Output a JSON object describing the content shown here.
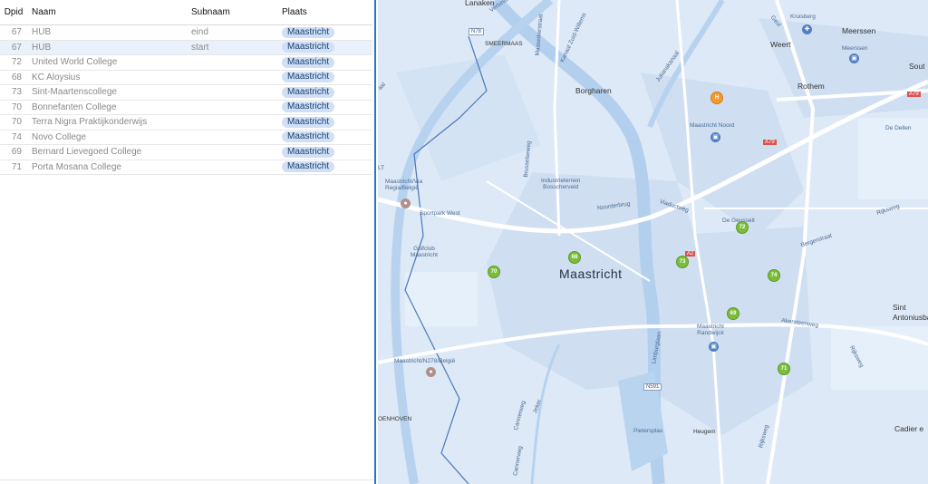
{
  "table": {
    "headers": {
      "dpid": "Dpid",
      "naam": "Naam",
      "subnaam": "Subnaam",
      "plaats": "Plaats"
    },
    "rows": [
      {
        "dpid": "67",
        "naam": "HUB",
        "subnaam": "eind",
        "plaats": "Maastricht"
      },
      {
        "dpid": "67",
        "naam": "HUB",
        "subnaam": "start",
        "plaats": "Maastricht"
      },
      {
        "dpid": "72",
        "naam": "United World College",
        "subnaam": "",
        "plaats": "Maastricht"
      },
      {
        "dpid": "68",
        "naam": "KC Aloysius",
        "subnaam": "",
        "plaats": "Maastricht"
      },
      {
        "dpid": "73",
        "naam": "Sint-Maartenscollege",
        "subnaam": "",
        "plaats": "Maastricht"
      },
      {
        "dpid": "70",
        "naam": "Bonnefanten College",
        "subnaam": "",
        "plaats": "Maastricht"
      },
      {
        "dpid": "70",
        "naam": "Terra Nigra Praktijkonderwijs",
        "subnaam": "",
        "plaats": "Maastricht"
      },
      {
        "dpid": "74",
        "naam": "Novo College",
        "subnaam": "",
        "plaats": "Maastricht"
      },
      {
        "dpid": "69",
        "naam": "Bernard Lievegoed College",
        "subnaam": "",
        "plaats": "Maastricht"
      },
      {
        "dpid": "71",
        "naam": "Porta Mosana College",
        "subnaam": "",
        "plaats": "Maastricht"
      }
    ]
  },
  "map": {
    "city": "Maastricht",
    "towns": {
      "lanaken": "Lanaken",
      "smeermaas": "SMEERMAAS",
      "borgharen": "Borgharen",
      "weert": "Weert",
      "meerssen": "Meerssen",
      "meerssen_station": "Meerssen",
      "rothem": "Rothem",
      "kruisberg": "Kruisberg",
      "de_dellen": "De Dellen",
      "sint_antoniusbank": "Sint\nAntoniusban",
      "cadier": "Cadier e",
      "heugem": "Heugem",
      "oenhoven": "OENHOVEN",
      "sout": "Sout"
    },
    "places": {
      "maastricht_noord": "Maastricht Noord",
      "industrieterrein": "Industrieterrein\nBosscherveld",
      "sportpark_west": "Sportpark West",
      "golfclub": "Golfclub\nMaastricht",
      "maastricht_via": "Maastricht/Via\nRegia/België",
      "maastricht_n278": "Maastricht/N278/België",
      "de_geusselt": "De Geusselt",
      "randwijck": "Maastricht\nRandwijck",
      "pietersplas": "Pietersplas",
      "lt": "LT"
    },
    "streets": {
      "noorderbrug": "Noorderbrug",
      "viaductweg": "Viaductweg",
      "akersteenweg": "Akersteenweg",
      "bergerstraat": "Bergerstraat",
      "rijksweg": "Rijksweg",
      "rijksweg2": "Rijksweg",
      "rijksweg3": "Rijksweg",
      "limburglaan": "Limburglaan",
      "brusselseweg": "Brusselseweg",
      "cannerweg": "Cannerweg",
      "cannerweg2": "Cannerweg",
      "julianakanaal": "Julianakanaal",
      "maaseikerstraat": "Maaseikerstraat",
      "kanaal": "Kanaal Zuid-Willems",
      "geul": "Geul",
      "verbind": "Verbindi",
      "jeker": "Jeker",
      "aal": "aal"
    },
    "roads": {
      "n78": "N78",
      "a79": "A79",
      "a79b": "A79",
      "a2": "A2",
      "n591": "N591"
    },
    "markers": [
      {
        "id": "72",
        "label": "72"
      },
      {
        "id": "68",
        "label": "68"
      },
      {
        "id": "70",
        "label": "70"
      },
      {
        "id": "73",
        "label": "73"
      },
      {
        "id": "74",
        "label": "74"
      },
      {
        "id": "69",
        "label": "69"
      },
      {
        "id": "71",
        "label": "71"
      },
      {
        "id": "h",
        "label": "H"
      }
    ],
    "colors": {
      "water": "#b9d4ef",
      "land": "#dde9f6",
      "road": "#ffffff",
      "marker": "#7bbd3b",
      "border": "#4a78b8"
    }
  }
}
